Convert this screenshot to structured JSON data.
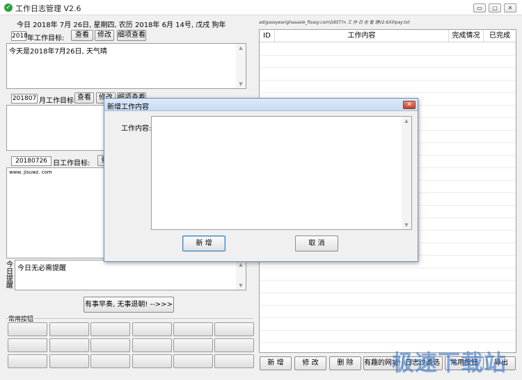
{
  "window": {
    "title": "工作日志管理 V2.6",
    "app_icon": "checkmark-icon",
    "controls": [
      "▭",
      "▢",
      "✕"
    ]
  },
  "date_line": "今日 2018年 7月 26日, 星期四, 农历 2018年 6月 14号, 戊戌 狗年",
  "url_line": "ad\\goooyearighaaasle_fisasy.com\\585T?n 工 作 日 志 管 理V2.6Xihpay.txt",
  "year_section": {
    "value": "2018",
    "label": "年工作目标:",
    "view_btn": "查看",
    "edit_btn": "修改",
    "detail_btn": "细项查看",
    "content": "今天是2018年7月26日, 天气晴"
  },
  "month_section": {
    "value": "201807",
    "label": "月工作目标:",
    "view_btn": "查看",
    "edit_btn": "修改",
    "detail_btn": "细项查看",
    "content": ""
  },
  "day_section": {
    "value": "20180726",
    "label": "日工作目标:",
    "view_btn": "查看",
    "content": "www. jisuwz. com"
  },
  "reminder": {
    "label": "今日提醒",
    "content": "今日无必需提醒"
  },
  "motto_button": "有事早奏, 无事退朝! -->>>",
  "common_buttons": {
    "label": "常用按钮"
  },
  "table": {
    "columns": [
      "ID",
      "工作内容",
      "完成情况",
      "已完成"
    ],
    "rows": []
  },
  "bottom_buttons": [
    "新 增",
    "修 改",
    "删 除",
    "有趣的网址",
    "日志过滤选",
    "常用按钮",
    "导出"
  ],
  "dialog": {
    "title": "新增工作内容",
    "field_label": "工作内容:",
    "field_value": "",
    "ok_button": "新 增",
    "cancel_button": "取 消"
  },
  "watermark": "极速下载站"
}
